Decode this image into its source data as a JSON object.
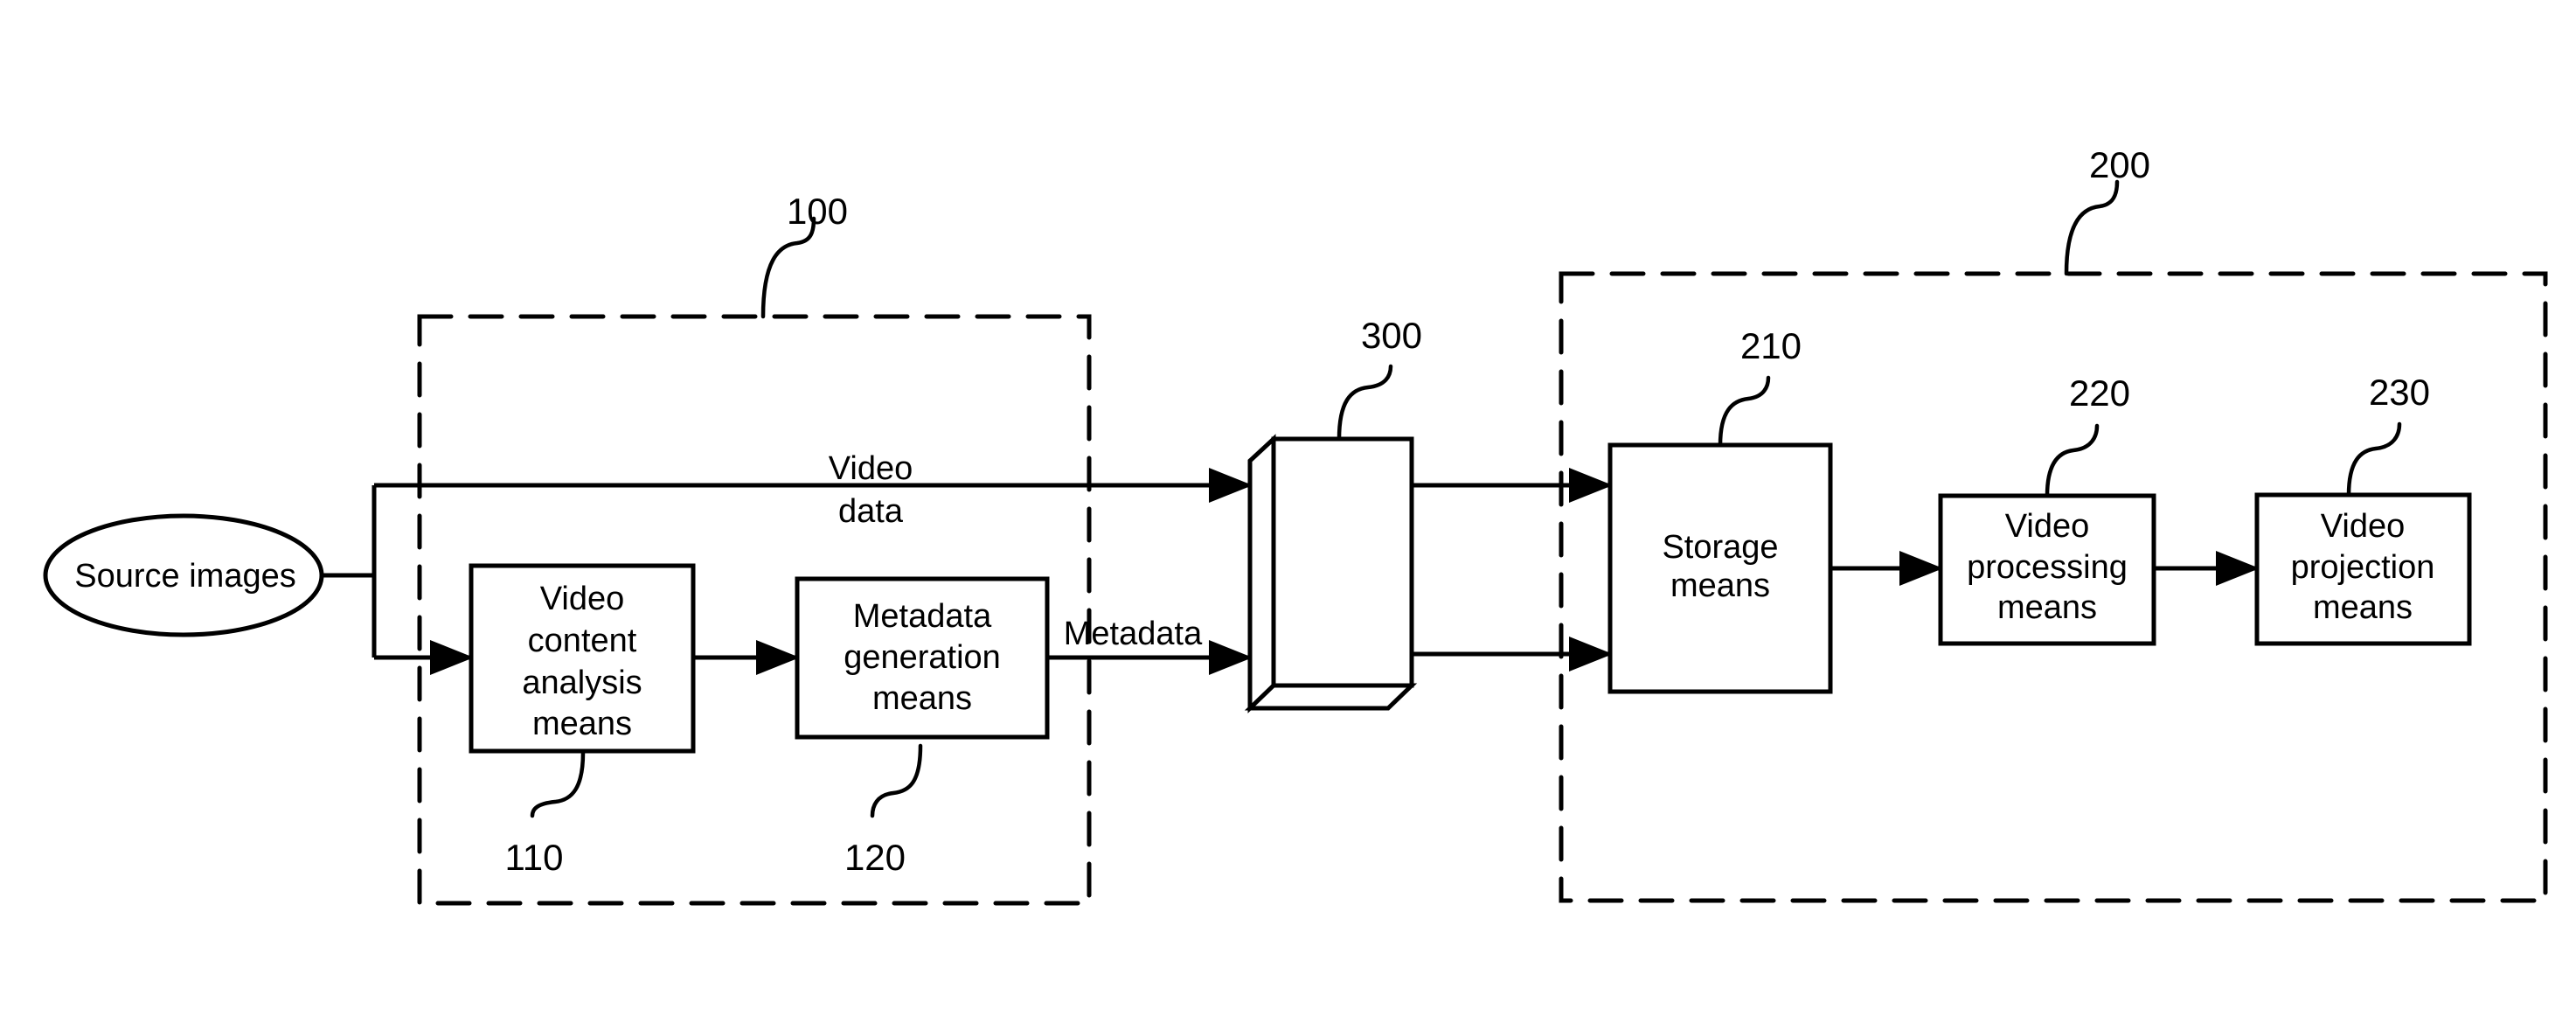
{
  "diagram": {
    "source": {
      "label": "Source images"
    },
    "groups": [
      {
        "id": "100",
        "ref": "100"
      },
      {
        "id": "200",
        "ref": "200"
      }
    ],
    "blocks": {
      "video_content_analysis": {
        "ref": "110",
        "lines": [
          "Video",
          "content",
          "analysis",
          "means"
        ]
      },
      "metadata_generation": {
        "ref": "120",
        "lines": [
          "Metadata",
          "generation",
          "means"
        ]
      },
      "storage_medium": {
        "ref": "300"
      },
      "storage_means": {
        "ref": "210",
        "lines": [
          "Storage",
          "means"
        ]
      },
      "video_processing": {
        "ref": "220",
        "lines": [
          "Video",
          "processing",
          "means"
        ]
      },
      "video_projection": {
        "ref": "230",
        "lines": [
          "Video",
          "projection",
          "means"
        ]
      }
    },
    "edge_labels": {
      "video_data": [
        "Video",
        "data"
      ],
      "metadata": "Metadata"
    },
    "colors": {
      "ink": "#000000",
      "background": "#ffffff"
    }
  }
}
